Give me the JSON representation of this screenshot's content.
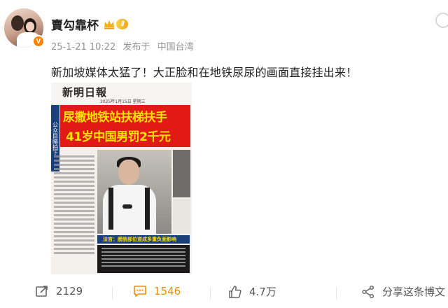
{
  "post": {
    "username": "賣勾靠杯",
    "level_badge": "Ⅱ",
    "verified_badge": "V",
    "timestamp": "25-1-21 10:22",
    "published_from": "发布于",
    "location": "中国台湾",
    "text": "新加坡媒体太猛了！大正脸和在地铁尿尿的画面直接挂出来！"
  },
  "newspaper": {
    "masthead": "新明日報",
    "date": "2025年1月15日 星期三",
    "side_label": "公众目睹拍下",
    "headline_line1": "尿撒地铁站扶梯扶手",
    "headline_line2": "41岁中国男罚2千元",
    "caption": "法官：膀胱部位道成多重负面影响"
  },
  "actions": {
    "repost_count": "2129",
    "comment_count": "1546",
    "like_count": "4.7万",
    "share_label": "分享这条博文"
  },
  "colors": {
    "comment_active": "#e98d0a",
    "headline_bg": "#e11a16",
    "headline_text": "#ffe100",
    "verified": "#ff8200"
  }
}
